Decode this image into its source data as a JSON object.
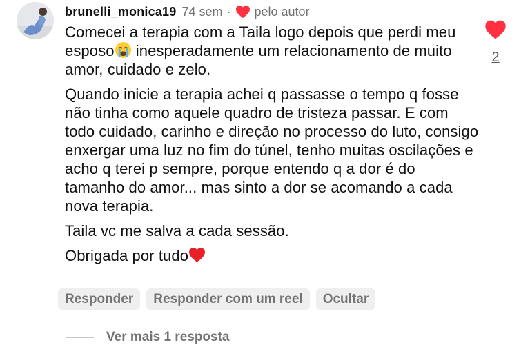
{
  "comment": {
    "username": "brunelli_monica19",
    "age": "74 sem",
    "separator": "·",
    "author_like_label": "pelo autor",
    "paragraphs": [
      {
        "before_emoji": "Comecei a terapia com a Taila logo depois que perdi meu esposo",
        "emoji": "crying-face-emoji",
        "after_emoji": " inesperadamente um relacionamento de muito amor, cuidado e zelo."
      },
      {
        "text": "Quando inicie a terapia achei q passasse o tempo q fosse não tinha como aquele quadro de tristeza passar. E com todo cuidado, carinho e direção no processo do luto, consigo enxergar uma luz no fim do túnel, tenho muitas oscilações e acho q terei p sempre, porque entendo q a dor é do tamanho do amor... mas sinto a dor se acomando a cada nova terapia."
      },
      {
        "text": "Taila vc me salva a cada sessão."
      },
      {
        "before_emoji": "Obrigada por tudo",
        "emoji": "red-heart-emoji",
        "after_emoji": ""
      }
    ]
  },
  "like": {
    "count": "2",
    "liked": true
  },
  "actions": {
    "reply_label": "Responder",
    "reply_reel_label": "Responder com um reel",
    "hide_label": "Ocultar"
  },
  "replies": {
    "more_label": "Ver mais 1 resposta"
  },
  "colors": {
    "heart": "#ff3040",
    "muted_text": "#737373",
    "pill_background": "#efefef"
  }
}
